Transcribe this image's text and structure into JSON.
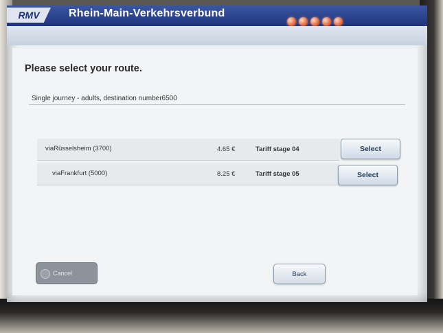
{
  "header": {
    "logo_text": "RMV",
    "title": "Rhein-Main-Verkehrsverbund",
    "language_buttons": [
      "lang-1",
      "lang-2",
      "lang-3",
      "lang-4",
      "lang-5"
    ]
  },
  "page": {
    "title": "Please select your route.",
    "journey_info": "Single journey - adults, destination number6500"
  },
  "routes": [
    {
      "name": "viaRüsselsheim (3700)",
      "price": "4.65 €",
      "tariff_stage": "Tariff stage 04",
      "select_label": "Select"
    },
    {
      "name": "viaFrankfurt (5000)",
      "price": "8.25 €",
      "tariff_stage": "Tariff stage 05",
      "select_label": "Select"
    }
  ],
  "footer": {
    "cancel_label": "Cancel",
    "back_label": "Back"
  },
  "colors": {
    "header_blue": "#1e347c",
    "accent_orange": "#e46b3c",
    "panel": "#f2f4f5"
  }
}
